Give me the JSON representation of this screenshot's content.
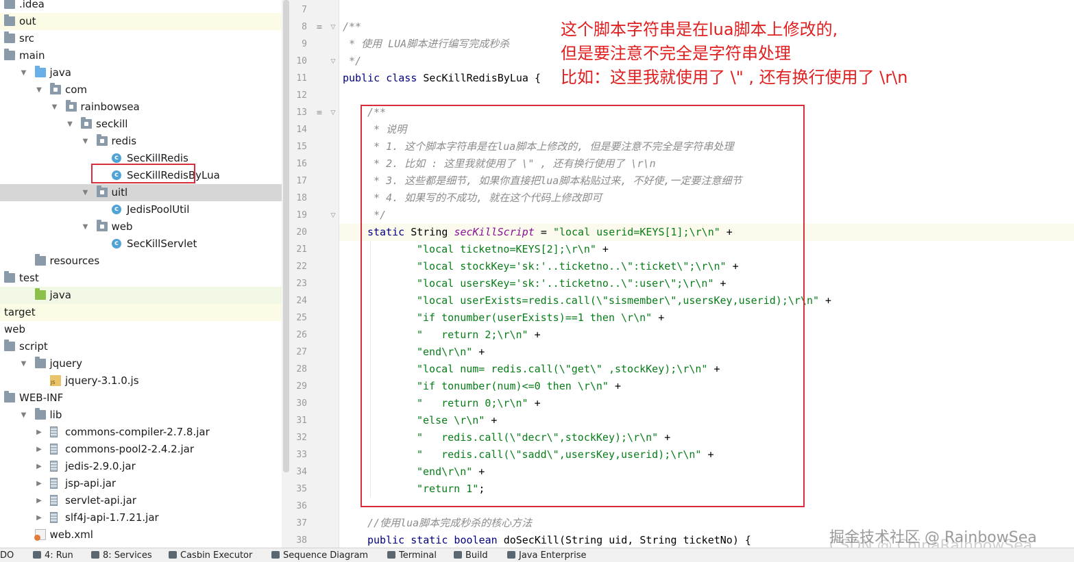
{
  "tree": [
    {
      "label": ".idea",
      "indent": 0,
      "icon": "folder",
      "arrow": "",
      "hl": ""
    },
    {
      "label": "out",
      "indent": 0,
      "icon": "folder",
      "arrow": "",
      "hl": "yellow"
    },
    {
      "label": "src",
      "indent": 0,
      "icon": "folder",
      "arrow": "",
      "hl": ""
    },
    {
      "label": "main",
      "indent": 0,
      "icon": "folder",
      "arrow": "",
      "hl": ""
    },
    {
      "label": "java",
      "indent": 1,
      "icon": "folder-blue",
      "arrow": "▼",
      "hl": ""
    },
    {
      "label": "com",
      "indent": 2,
      "icon": "package",
      "arrow": "▼",
      "hl": ""
    },
    {
      "label": "rainbowsea",
      "indent": 3,
      "icon": "package",
      "arrow": "▼",
      "hl": ""
    },
    {
      "label": "seckill",
      "indent": 4,
      "icon": "package",
      "arrow": "▼",
      "hl": ""
    },
    {
      "label": "redis",
      "indent": 5,
      "icon": "package",
      "arrow": "▼",
      "hl": ""
    },
    {
      "label": "SecKillRedis",
      "indent": 6,
      "icon": "class",
      "arrow": "",
      "hl": ""
    },
    {
      "label": "SecKillRedisByLua",
      "indent": 6,
      "icon": "class",
      "arrow": "",
      "hl": ""
    },
    {
      "label": "uitl",
      "indent": 5,
      "icon": "package",
      "arrow": "▼",
      "hl": "gray"
    },
    {
      "label": "JedisPoolUtil",
      "indent": 6,
      "icon": "class",
      "arrow": "",
      "hl": ""
    },
    {
      "label": "web",
      "indent": 5,
      "icon": "package",
      "arrow": "▼",
      "hl": ""
    },
    {
      "label": "SecKillServlet",
      "indent": 6,
      "icon": "class",
      "arrow": "",
      "hl": ""
    },
    {
      "label": "resources",
      "indent": 1,
      "icon": "folder",
      "arrow": "",
      "hl": ""
    },
    {
      "label": "test",
      "indent": 0,
      "icon": "folder",
      "arrow": "",
      "hl": ""
    },
    {
      "label": "java",
      "indent": 1,
      "icon": "folder-green",
      "arrow": "",
      "hl": "green"
    },
    {
      "label": "target",
      "indent": 0,
      "icon": "none",
      "arrow": "",
      "hl": "yellow"
    },
    {
      "label": "web",
      "indent": 0,
      "icon": "none",
      "arrow": "",
      "hl": ""
    },
    {
      "label": "script",
      "indent": 0,
      "icon": "folder",
      "arrow": "",
      "hl": ""
    },
    {
      "label": "jquery",
      "indent": 1,
      "icon": "folder",
      "arrow": "▼",
      "hl": ""
    },
    {
      "label": "jquery-3.1.0.js",
      "indent": 2,
      "icon": "js",
      "arrow": "",
      "hl": ""
    },
    {
      "label": "WEB-INF",
      "indent": 0,
      "icon": "folder",
      "arrow": "",
      "hl": ""
    },
    {
      "label": "lib",
      "indent": 1,
      "icon": "folder",
      "arrow": "▼",
      "hl": ""
    },
    {
      "label": "commons-compiler-2.7.8.jar",
      "indent": 2,
      "icon": "jar",
      "arrow": "▶",
      "hl": ""
    },
    {
      "label": "commons-pool2-2.4.2.jar",
      "indent": 2,
      "icon": "jar",
      "arrow": "▶",
      "hl": ""
    },
    {
      "label": "jedis-2.9.0.jar",
      "indent": 2,
      "icon": "jar",
      "arrow": "▶",
      "hl": ""
    },
    {
      "label": "jsp-api.jar",
      "indent": 2,
      "icon": "jar",
      "arrow": "▶",
      "hl": ""
    },
    {
      "label": "servlet-api.jar",
      "indent": 2,
      "icon": "jar",
      "arrow": "▶",
      "hl": ""
    },
    {
      "label": "slf4j-api-1.7.21.jar",
      "indent": 2,
      "icon": "jar",
      "arrow": "▶",
      "hl": ""
    },
    {
      "label": "web.xml",
      "indent": 1,
      "icon": "xml",
      "arrow": "",
      "hl": ""
    }
  ],
  "editor": {
    "line_numbers": [
      "7",
      "8",
      "9",
      "10",
      "11",
      "12",
      "13",
      "14",
      "15",
      "16",
      "17",
      "18",
      "19",
      "20",
      "21",
      "22",
      "23",
      "24",
      "25",
      "26",
      "27",
      "28",
      "29",
      "30",
      "31",
      "32",
      "33",
      "34",
      "35",
      "36",
      "37",
      "38"
    ],
    "lines": [
      {
        "indent": 0,
        "cur": false,
        "tokens": []
      },
      {
        "indent": 0,
        "cur": false,
        "tokens": [
          {
            "t": "/**",
            "c": "cm"
          }
        ]
      },
      {
        "indent": 0,
        "cur": false,
        "tokens": [
          {
            "t": " * 使用 LUA脚本进行编写完成秒杀",
            "c": "cm"
          }
        ]
      },
      {
        "indent": 0,
        "cur": false,
        "tokens": [
          {
            "t": " */",
            "c": "cm"
          }
        ]
      },
      {
        "indent": 0,
        "cur": false,
        "tokens": [
          {
            "t": "public class ",
            "c": "kw"
          },
          {
            "t": "SecKillRedisByLua {",
            "c": ""
          }
        ]
      },
      {
        "indent": 0,
        "cur": false,
        "tokens": []
      },
      {
        "indent": 1,
        "cur": false,
        "tokens": [
          {
            "t": "/**",
            "c": "cm"
          }
        ]
      },
      {
        "indent": 1,
        "cur": false,
        "tokens": [
          {
            "t": " * 说明",
            "c": "cm"
          }
        ]
      },
      {
        "indent": 1,
        "cur": false,
        "tokens": [
          {
            "t": " * 1. 这个脚本字符串是在lua脚本上修改的, 但是要注意不完全是字符串处理",
            "c": "cm"
          }
        ]
      },
      {
        "indent": 1,
        "cur": false,
        "tokens": [
          {
            "t": " * 2. 比如 : 这里我就使用了 \\\" , 还有换行使用了 \\r\\n",
            "c": "cm"
          }
        ]
      },
      {
        "indent": 1,
        "cur": false,
        "tokens": [
          {
            "t": " * 3. 这些都是细节, 如果你直接把lua脚本粘贴过来, 不好使,一定要注意细节",
            "c": "cm"
          }
        ]
      },
      {
        "indent": 1,
        "cur": false,
        "tokens": [
          {
            "t": " * 4. 如果写的不成功, 就在这个代码上修改即可",
            "c": "cm"
          }
        ]
      },
      {
        "indent": 1,
        "cur": false,
        "tokens": [
          {
            "t": " */",
            "c": "cm"
          }
        ]
      },
      {
        "indent": 1,
        "cur": true,
        "tokens": [
          {
            "t": "static ",
            "c": "kw"
          },
          {
            "t": "String ",
            "c": ""
          },
          {
            "t": "secKillScript",
            "c": "fld"
          },
          {
            "t": " = ",
            "c": ""
          },
          {
            "t": "\"local userid=KEYS[1];\\r\\n\"",
            "c": "st"
          },
          {
            "t": " +",
            "c": ""
          }
        ]
      },
      {
        "indent": 3,
        "cur": false,
        "tokens": [
          {
            "t": "\"local ticketno=KEYS[2];\\r\\n\"",
            "c": "st"
          },
          {
            "t": " +",
            "c": ""
          }
        ]
      },
      {
        "indent": 3,
        "cur": false,
        "tokens": [
          {
            "t": "\"local stockKey='sk:'..ticketno..\\\":ticket\\\";\\r\\n\"",
            "c": "st"
          },
          {
            "t": " +",
            "c": ""
          }
        ]
      },
      {
        "indent": 3,
        "cur": false,
        "tokens": [
          {
            "t": "\"local usersKey='sk:'..ticketno..\\\":user\\\";\\r\\n\"",
            "c": "st"
          },
          {
            "t": " +",
            "c": ""
          }
        ]
      },
      {
        "indent": 3,
        "cur": false,
        "tokens": [
          {
            "t": "\"local userExists=redis.call(\\\"sismember\\\",usersKey,userid);\\r\\n\"",
            "c": "st"
          },
          {
            "t": " +",
            "c": ""
          }
        ]
      },
      {
        "indent": 3,
        "cur": false,
        "tokens": [
          {
            "t": "\"if tonumber(userExists)==1 then \\r\\n\"",
            "c": "st"
          },
          {
            "t": " +",
            "c": ""
          }
        ]
      },
      {
        "indent": 3,
        "cur": false,
        "tokens": [
          {
            "t": "\"   return 2;\\r\\n\"",
            "c": "st"
          },
          {
            "t": " +",
            "c": ""
          }
        ]
      },
      {
        "indent": 3,
        "cur": false,
        "tokens": [
          {
            "t": "\"end\\r\\n\"",
            "c": "st"
          },
          {
            "t": " +",
            "c": ""
          }
        ]
      },
      {
        "indent": 3,
        "cur": false,
        "tokens": [
          {
            "t": "\"local num= redis.call(\\\"get\\\" ,stockKey);\\r\\n\"",
            "c": "st"
          },
          {
            "t": " +",
            "c": ""
          }
        ]
      },
      {
        "indent": 3,
        "cur": false,
        "tokens": [
          {
            "t": "\"if tonumber(num)<=0 then \\r\\n\"",
            "c": "st"
          },
          {
            "t": " +",
            "c": ""
          }
        ]
      },
      {
        "indent": 3,
        "cur": false,
        "tokens": [
          {
            "t": "\"   return 0;\\r\\n\"",
            "c": "st"
          },
          {
            "t": " +",
            "c": ""
          }
        ]
      },
      {
        "indent": 3,
        "cur": false,
        "tokens": [
          {
            "t": "\"else \\r\\n\"",
            "c": "st"
          },
          {
            "t": " +",
            "c": ""
          }
        ]
      },
      {
        "indent": 3,
        "cur": false,
        "tokens": [
          {
            "t": "\"   redis.call(\\\"decr\\\",stockKey);\\r\\n\"",
            "c": "st"
          },
          {
            "t": " +",
            "c": ""
          }
        ]
      },
      {
        "indent": 3,
        "cur": false,
        "tokens": [
          {
            "t": "\"   redis.call(\\\"sadd\\\",usersKey,userid);\\r\\n\"",
            "c": "st"
          },
          {
            "t": " +",
            "c": ""
          }
        ]
      },
      {
        "indent": 3,
        "cur": false,
        "tokens": [
          {
            "t": "\"end\\r\\n\"",
            "c": "st"
          },
          {
            "t": " +",
            "c": ""
          }
        ]
      },
      {
        "indent": 3,
        "cur": false,
        "tokens": [
          {
            "t": "\"return 1\"",
            "c": "st"
          },
          {
            "t": ";",
            "c": ""
          }
        ]
      },
      {
        "indent": 0,
        "cur": false,
        "tokens": []
      },
      {
        "indent": 1,
        "cur": false,
        "tokens": [
          {
            "t": "//使用lua脚本完成秒杀的核心方法",
            "c": "cm"
          }
        ]
      },
      {
        "indent": 1,
        "cur": false,
        "tokens": [
          {
            "t": "public static boolean ",
            "c": "kw"
          },
          {
            "t": "doSecKill(String uid, String ticketNo) {",
            "c": ""
          }
        ]
      }
    ]
  },
  "annotation": {
    "line1": "这个脚本字符串是在lua脚本上修改的,",
    "line2": "但是要注意不完全是字符串处理",
    "line3": "比如：这里我就使用了 \\\" , 还有换行使用了 \\r\\n"
  },
  "watermark": {
    "text1": "掘金技术社区 @ RainbowSea",
    "text2": "CSDN @ ChinaRainbowSea"
  },
  "bottom_bar": {
    "items": [
      {
        "label": "DO",
        "icon": "none"
      },
      {
        "label": "4: Run",
        "icon": "run-icon"
      },
      {
        "label": "8: Services",
        "icon": "services-icon"
      },
      {
        "label": "Casbin Executor",
        "icon": "casbin-icon"
      },
      {
        "label": "Sequence Diagram",
        "icon": "sequence-icon"
      },
      {
        "label": "Terminal",
        "icon": "terminal-icon"
      },
      {
        "label": "Build",
        "icon": "build-icon"
      },
      {
        "label": "Java Enterprise",
        "icon": "java-enterprise-icon"
      }
    ]
  },
  "colors": {
    "annotation_red": "#e02020",
    "highlight_box": "#d92d3b",
    "string": "#067d17",
    "keyword": "#000080",
    "comment": "#8c8c8c",
    "field": "#871094"
  }
}
